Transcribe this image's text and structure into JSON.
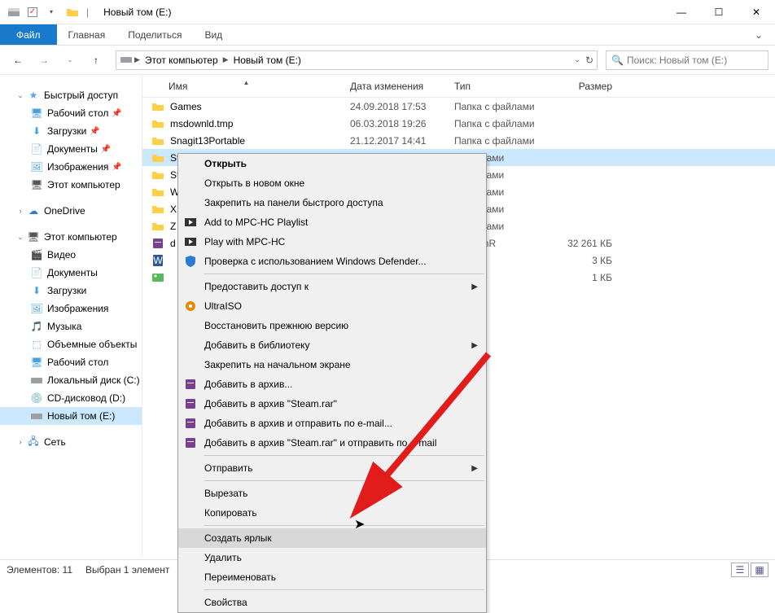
{
  "window": {
    "title": "Новый том (E:)",
    "win_controls": {
      "min": "—",
      "max": "☐",
      "close": "✕"
    }
  },
  "ribbon": {
    "file": "Файл",
    "tabs": [
      "Главная",
      "Поделиться",
      "Вид"
    ]
  },
  "nav": {
    "back": "←",
    "fwd": "→",
    "up": "↑",
    "path": [
      "Этот компьютер",
      "Новый том (E:)"
    ],
    "refresh": "↻",
    "search_placeholder": "Поиск: Новый том (E:)"
  },
  "tree": {
    "quick": {
      "label": "Быстрый доступ",
      "items": [
        "Рабочий стол",
        "Загрузки",
        "Документы",
        "Изображения",
        "Этот компьютер"
      ]
    },
    "onedrive": "OneDrive",
    "thispc": {
      "label": "Этот компьютер",
      "items": [
        "Видео",
        "Документы",
        "Загрузки",
        "Изображения",
        "Музыка",
        "Объемные объекты",
        "Рабочий стол",
        "Локальный диск (C:)",
        "CD-дисковод (D:)",
        "Новый том (E:)"
      ]
    },
    "network": "Сеть"
  },
  "columns": {
    "name": "Имя",
    "date": "Дата изменения",
    "type": "Тип",
    "size": "Размер"
  },
  "files": [
    {
      "icon": "folder",
      "name": "Games",
      "date": "24.09.2018 17:53",
      "type": "Папка с файлами",
      "size": ""
    },
    {
      "icon": "folder",
      "name": "msdownld.tmp",
      "date": "06.03.2018 19:26",
      "type": "Папка с файлами",
      "size": ""
    },
    {
      "icon": "folder",
      "name": "Snagit13Portable",
      "date": "21.12.2017 14:41",
      "type": "Папка с файлами",
      "size": ""
    },
    {
      "icon": "folder",
      "name": "St",
      "date": "",
      "type": "с файлами",
      "size": "",
      "selected": true
    },
    {
      "icon": "folder",
      "name": "St",
      "date": "",
      "type": "с файлами",
      "size": ""
    },
    {
      "icon": "folder",
      "name": "W",
      "date": "",
      "type": "с файлами",
      "size": ""
    },
    {
      "icon": "folder",
      "name": "X",
      "date": "",
      "type": "с файлами",
      "size": ""
    },
    {
      "icon": "folder",
      "name": "Z",
      "date": "",
      "type": "с файлами",
      "size": ""
    },
    {
      "icon": "rar",
      "name": "d",
      "date": "",
      "type": "IP - WinR",
      "size": "32 261 КБ"
    },
    {
      "icon": "doc",
      "name": "",
      "date": "",
      "type": "",
      "size": "3 КБ"
    },
    {
      "icon": "img",
      "name": "",
      "date": "",
      "type": "",
      "size": "1 КБ"
    }
  ],
  "context_menu": [
    {
      "label": "Открыть",
      "bold": true
    },
    {
      "label": "Открыть в новом окне"
    },
    {
      "label": "Закрепить на панели быстрого доступа"
    },
    {
      "label": "Add to MPC-HC Playlist",
      "icon": "mpc"
    },
    {
      "label": "Play with MPC-HC",
      "icon": "mpc"
    },
    {
      "label": "Проверка с использованием Windows Defender...",
      "icon": "defender"
    },
    {
      "sep": true
    },
    {
      "label": "Предоставить доступ к",
      "sub": true
    },
    {
      "label": "UltraISO",
      "icon": "ultra"
    },
    {
      "label": "Восстановить прежнюю версию"
    },
    {
      "label": "Добавить в библиотеку",
      "sub": true
    },
    {
      "label": "Закрепить на начальном экране"
    },
    {
      "label": "Добавить в архив...",
      "icon": "rar"
    },
    {
      "label": "Добавить в архив \"Steam.rar\"",
      "icon": "rar"
    },
    {
      "label": "Добавить в архив и отправить по e-mail...",
      "icon": "rar"
    },
    {
      "label": "Добавить в архив \"Steam.rar\" и отправить по e-mail",
      "icon": "rar"
    },
    {
      "sep": true
    },
    {
      "label": "Отправить",
      "sub": true
    },
    {
      "sep": true
    },
    {
      "label": "Вырезать"
    },
    {
      "label": "Копировать"
    },
    {
      "sep": true
    },
    {
      "label": "Создать ярлык",
      "hover": true
    },
    {
      "label": "Удалить"
    },
    {
      "label": "Переименовать"
    },
    {
      "sep": true
    },
    {
      "label": "Свойства"
    }
  ],
  "status": {
    "count": "Элементов: 11",
    "sel": "Выбран 1 элемент"
  }
}
